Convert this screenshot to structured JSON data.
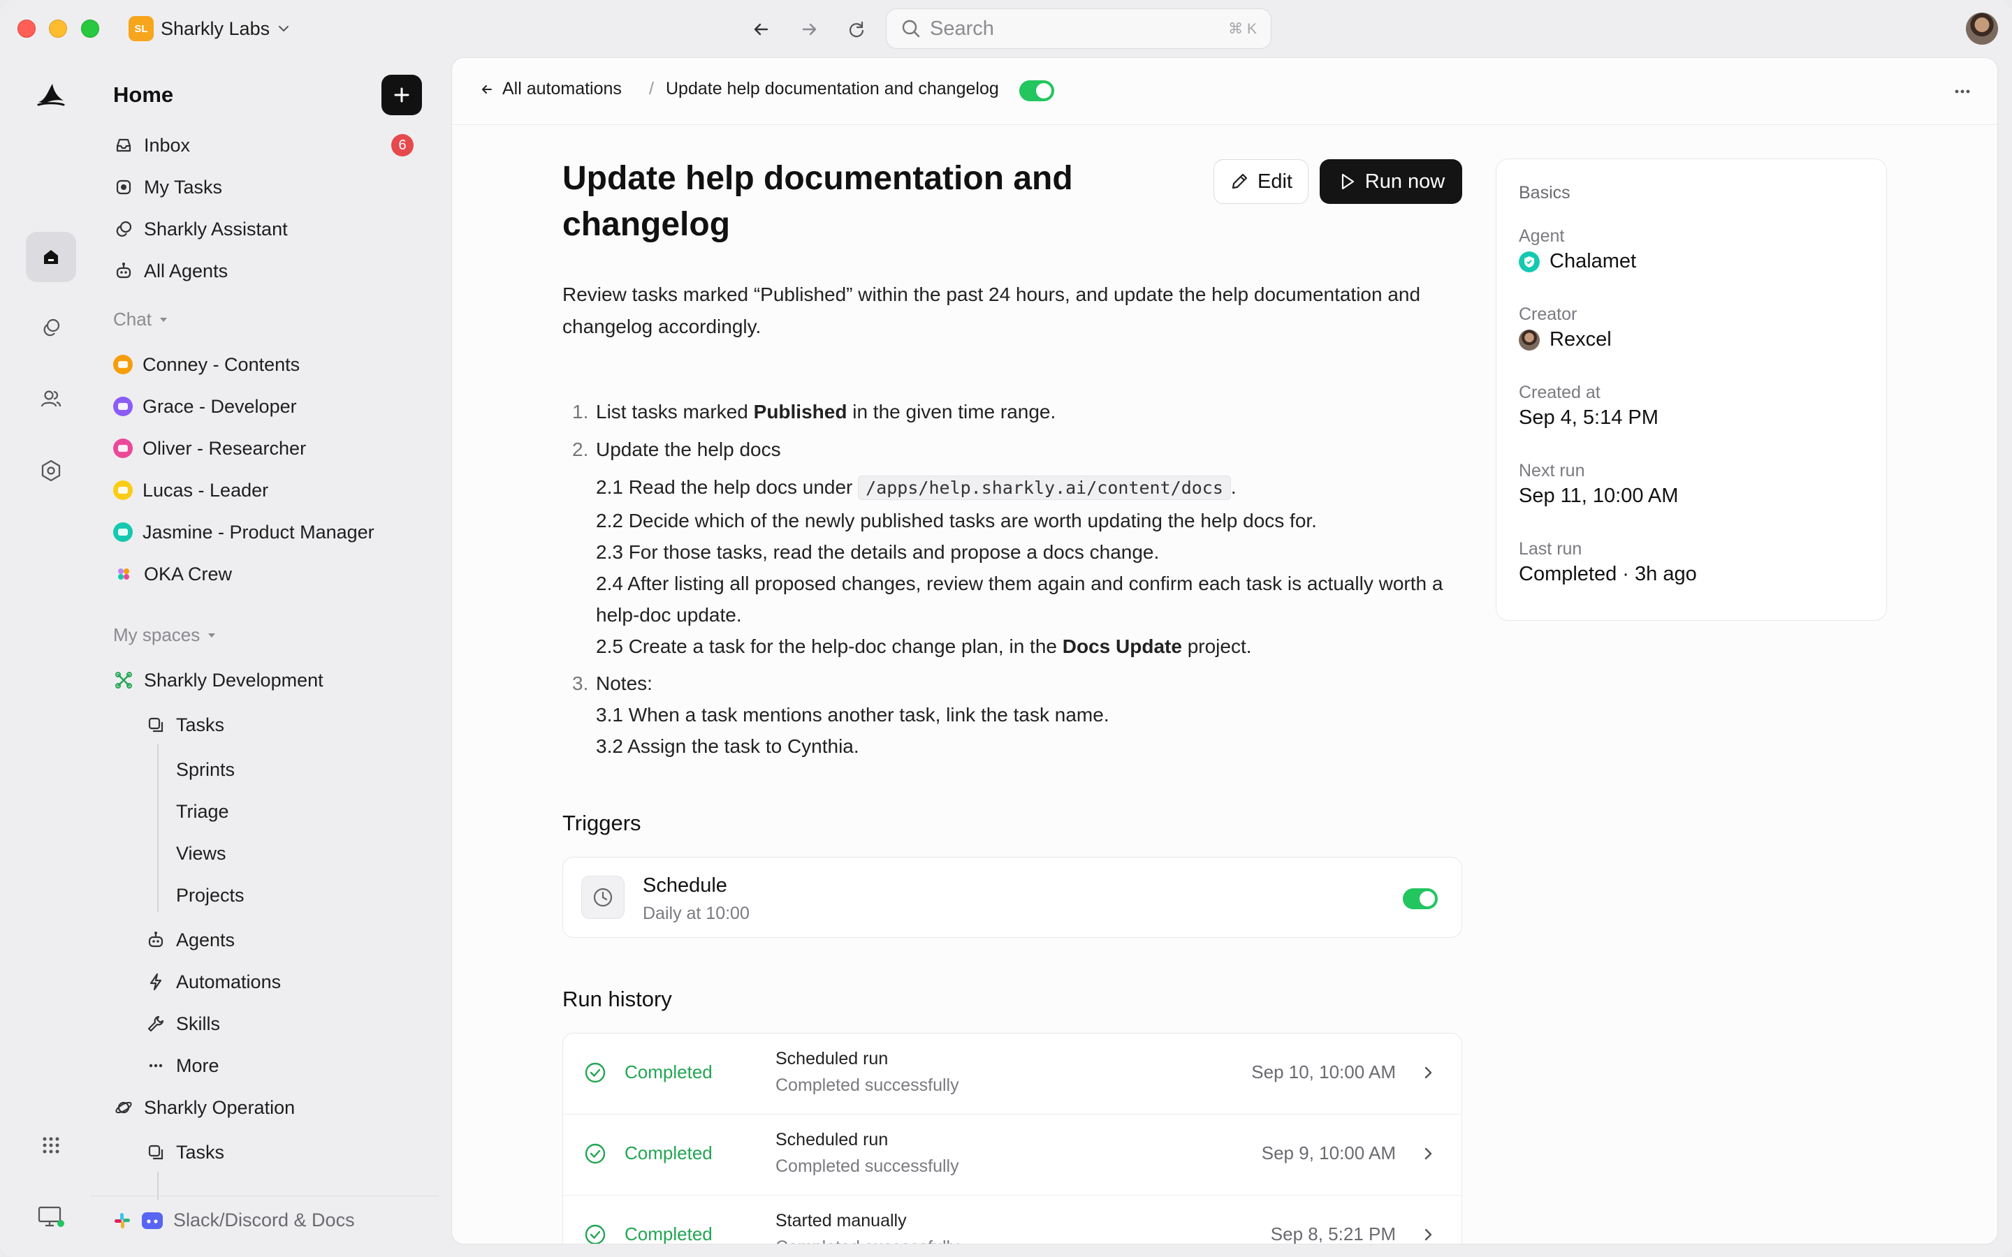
{
  "workspace": {
    "initials": "SL",
    "name": "Sharkly Labs"
  },
  "search": {
    "placeholder": "Search",
    "shortcut": "⌘ K"
  },
  "sidebar": {
    "home": "Home",
    "top_items": [
      {
        "label": "Inbox",
        "icon": "inbox-icon",
        "badge": "6"
      },
      {
        "label": "My Tasks",
        "icon": "target-icon"
      },
      {
        "label": "Sharkly Assistant",
        "icon": "chat-bubbles-icon"
      },
      {
        "label": "All Agents",
        "icon": "robot-icon"
      }
    ],
    "chat_section": "Chat",
    "chats": [
      {
        "label": "Conney - Contents",
        "color": "#f59e0b"
      },
      {
        "label": "Grace - Developer",
        "color": "#8b5cf6"
      },
      {
        "label": "Oliver - Researcher",
        "color": "#ec4899"
      },
      {
        "label": "Lucas - Leader",
        "color": "#facc15"
      },
      {
        "label": "Jasmine - Product Manager",
        "color": "#14c9b0"
      },
      {
        "label": "OKA Crew",
        "color": "#c084fc"
      }
    ],
    "spaces_section": "My spaces",
    "spaces": {
      "dev": "Sharkly Development",
      "tasks": "Tasks",
      "task_children": [
        "Sprints",
        "Triage",
        "Views",
        "Projects"
      ],
      "agents": "Agents",
      "automations": "Automations",
      "skills": "Skills",
      "more": "More",
      "ops": "Sharkly Operation",
      "ops_tasks": "Tasks"
    },
    "footer": "Slack/Discord & Docs"
  },
  "breadcrumb": {
    "back": "All automations",
    "current": "Update help documentation and changelog"
  },
  "automation": {
    "title": "Update help documentation and changelog",
    "edit_label": "Edit",
    "run_label": "Run now",
    "description": "Review tasks marked “Published” within the past 24 hours, and update the help documentation and changelog accordingly.",
    "step1_pre": "List tasks marked ",
    "step1_bold": "Published",
    "step1_post": " in the given time range.",
    "step2": "Update the help docs",
    "step2_1_pre": "2.1 Read the help docs under ",
    "step2_1_code": "/apps/help.sharkly.ai/content/docs",
    "step2_1_post": ".",
    "step2_2": "2.2 Decide which of the newly published tasks are worth updating the help docs for.",
    "step2_3": "2.3 For those tasks, read the details and propose a docs change.",
    "step2_4": "2.4 After listing all proposed changes, review them again and confirm each task is actually worth a help-doc update.",
    "step2_5_pre": "2.5 Create a task for the help-doc change plan, in the ",
    "step2_5_bold": "Docs Update",
    "step2_5_post": " project.",
    "step3": "Notes:",
    "step3_1": "3.1 When a task mentions another task, link the task name.",
    "step3_2": "3.2 Assign the task to Cynthia."
  },
  "triggers": {
    "heading": "Triggers",
    "name": "Schedule",
    "detail": "Daily at 10:00",
    "enabled": true
  },
  "history": {
    "heading": "Run history",
    "rows": [
      {
        "status": "Completed",
        "title": "Scheduled run",
        "sub": "Completed successfully",
        "date": "Sep 10, 10:00 AM"
      },
      {
        "status": "Completed",
        "title": "Scheduled run",
        "sub": "Completed successfully",
        "date": "Sep 9, 10:00 AM"
      },
      {
        "status": "Completed",
        "title": "Started manually",
        "sub": "Completed successfully",
        "date": "Sep 8, 5:21 PM"
      }
    ]
  },
  "basics": {
    "heading": "Basics",
    "agent_label": "Agent",
    "agent": "Chalamet",
    "creator_label": "Creator",
    "creator": "Rexcel",
    "created_label": "Created at",
    "created": "Sep 4, 5:14 PM",
    "next_label": "Next run",
    "next": "Sep 11, 10:00 AM",
    "last_label": "Last run",
    "last": "Completed · 3h ago"
  },
  "colors": {
    "accent_green": "#22c55e",
    "badge_red": "#e5484d",
    "brand_orange": "#f7a51c"
  }
}
